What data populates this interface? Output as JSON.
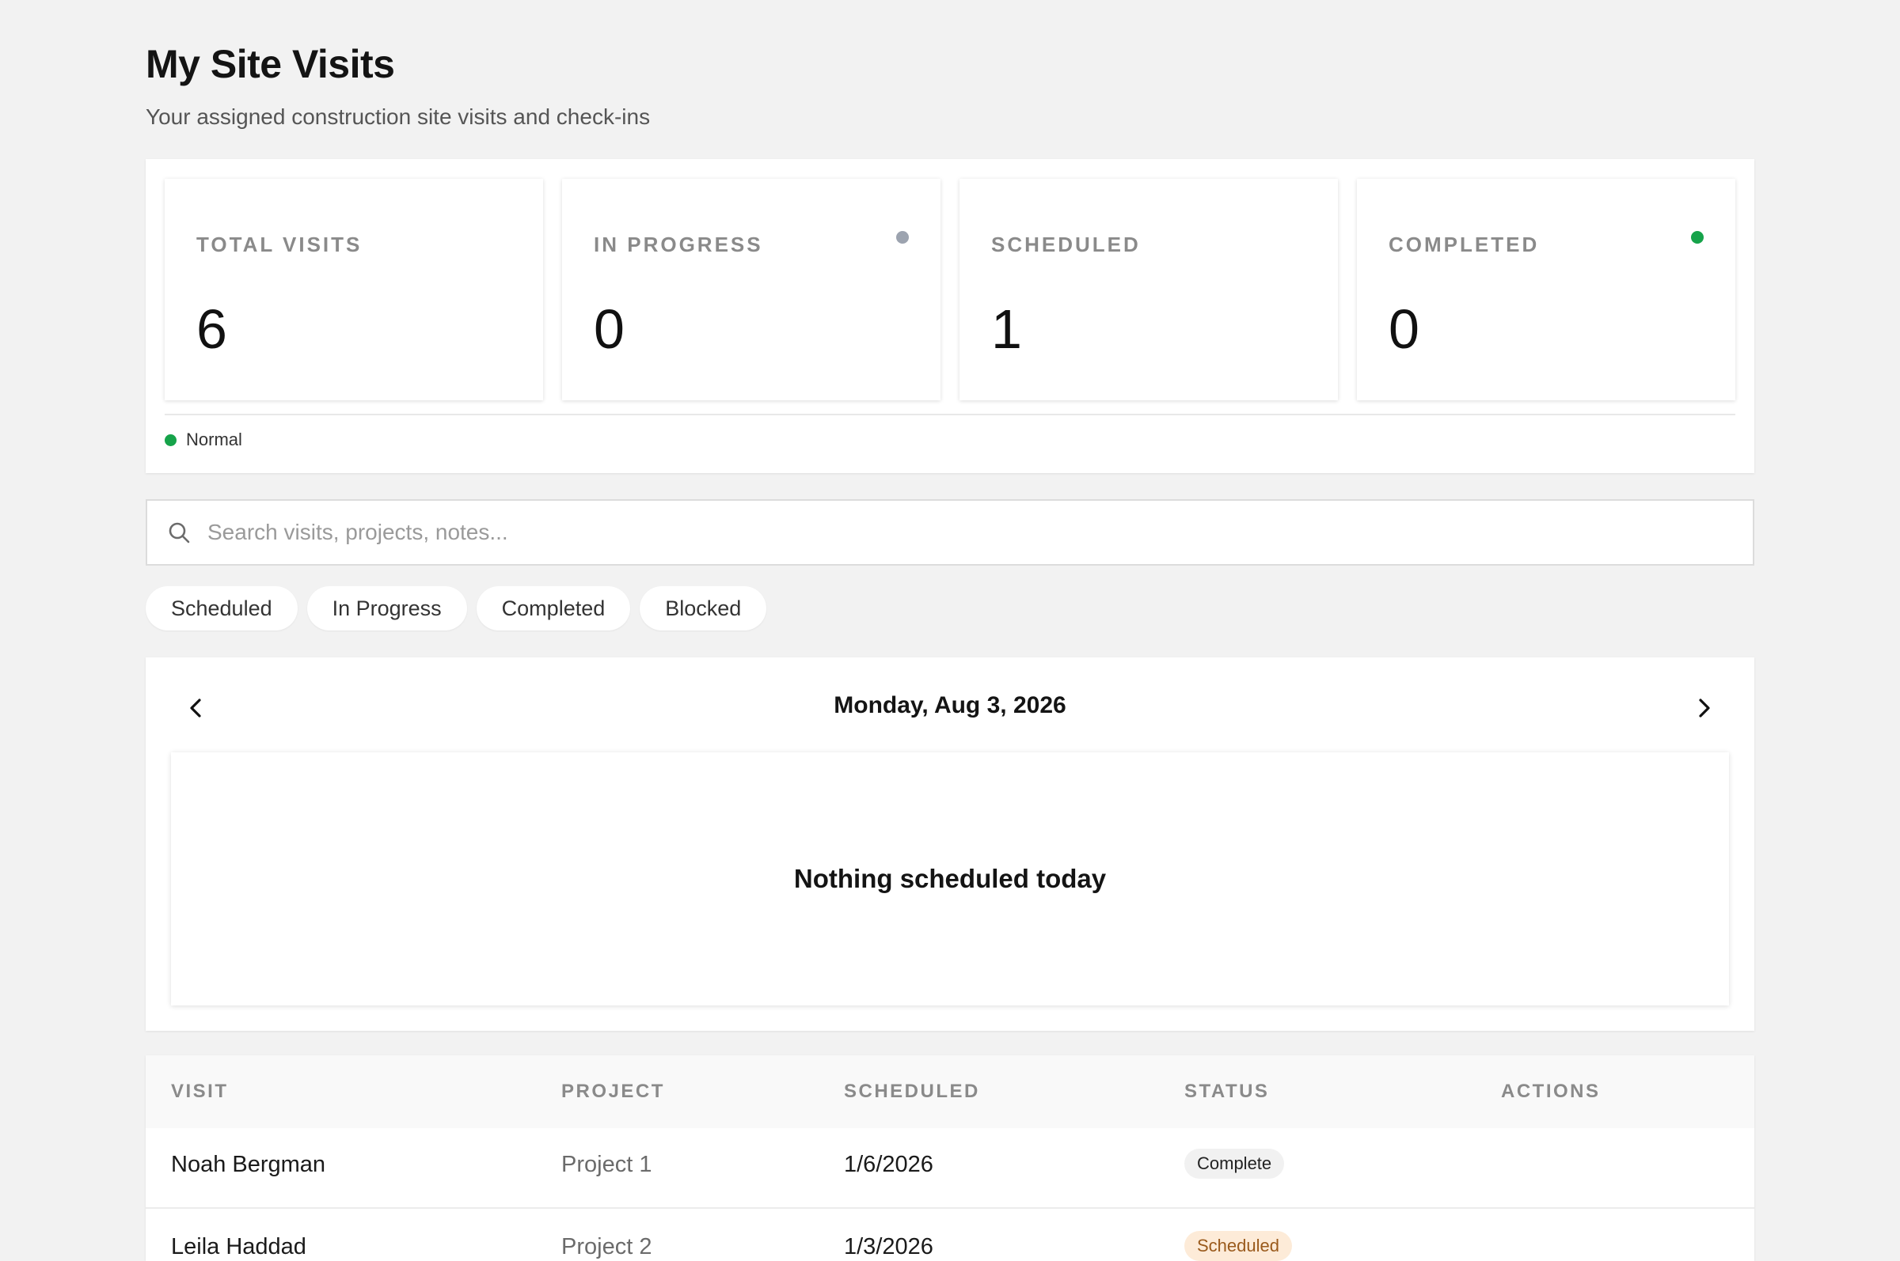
{
  "header": {
    "title": "My Site Visits",
    "subtitle": "Your assigned construction site visits and check-ins"
  },
  "stats": [
    {
      "label": "TOTAL VISITS",
      "value": "6"
    },
    {
      "label": "IN PROGRESS",
      "value": "0",
      "dot_color": "#9ca3af"
    },
    {
      "label": "SCHEDULED",
      "value": "1"
    },
    {
      "label": "COMPLETED",
      "value": "0",
      "dot_color": "#16a34a"
    }
  ],
  "legend": {
    "label": "Normal",
    "color": "#16a34a"
  },
  "search": {
    "placeholder": "Search visits, projects, notes...",
    "value": ""
  },
  "filters": [
    "Scheduled",
    "In Progress",
    "Completed",
    "Blocked"
  ],
  "calendar": {
    "date": "Monday, Aug 3, 2026",
    "empty_message": "Nothing scheduled today"
  },
  "table": {
    "columns": [
      "VISIT",
      "PROJECT",
      "SCHEDULED",
      "STATUS",
      "ACTIONS"
    ],
    "rows": [
      {
        "visit": "Noah Bergman",
        "project": "Project 1",
        "scheduled": "1/6/2026",
        "status": "Complete",
        "status_bg": "#f1f1f1",
        "status_color": "#222222"
      },
      {
        "visit": "Leila Haddad",
        "project": "Project 2",
        "scheduled": "1/3/2026",
        "status": "Scheduled",
        "status_bg": "#fdebd8",
        "status_color": "#9a5a1c"
      }
    ]
  },
  "icons": {
    "search": "search-icon",
    "prev": "chevron-left-icon",
    "next": "chevron-right-icon"
  }
}
